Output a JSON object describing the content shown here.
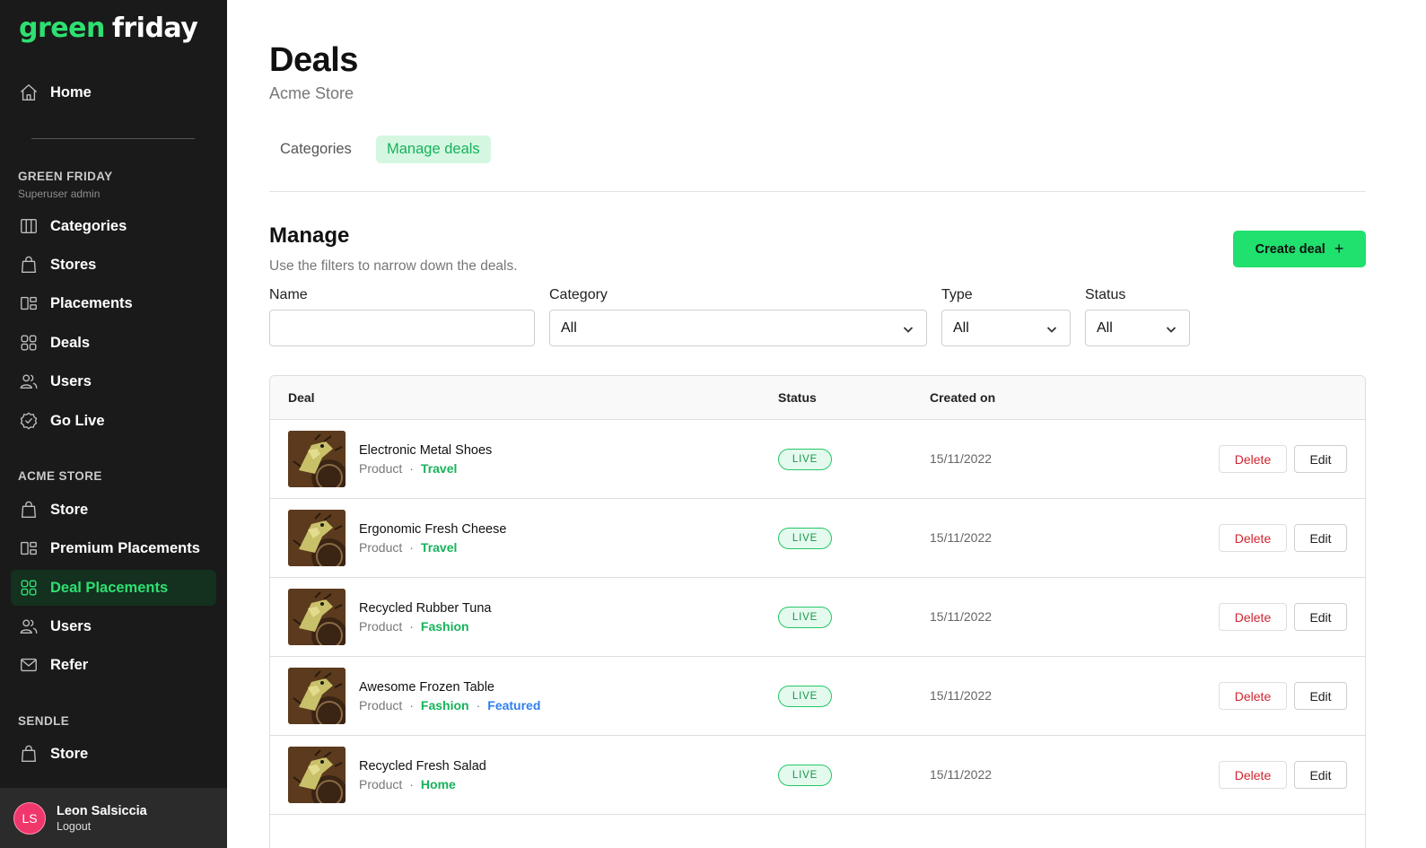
{
  "brand": {
    "part1": "green",
    "part2": "friday",
    "accent": "#2ee071"
  },
  "sidebar": {
    "home": {
      "label": "Home",
      "icon": "home-icon"
    },
    "section1": {
      "title": "GREEN FRIDAY",
      "subtitle": "Superuser admin"
    },
    "section1_items": [
      {
        "label": "Categories",
        "icon": "columns-icon"
      },
      {
        "label": "Stores",
        "icon": "shopping-bag-icon"
      },
      {
        "label": "Placements",
        "icon": "placements-icon"
      },
      {
        "label": "Deals",
        "icon": "grid-icon"
      },
      {
        "label": "Users",
        "icon": "users-icon"
      },
      {
        "label": "Go Live",
        "icon": "check-badge-icon"
      }
    ],
    "section2": {
      "title": "ACME STORE"
    },
    "section2_items": [
      {
        "label": "Store",
        "icon": "shopping-bag-icon"
      },
      {
        "label": "Premium Placements",
        "icon": "placements-icon"
      },
      {
        "label": "Deal Placements",
        "icon": "grid-icon",
        "active": true
      },
      {
        "label": "Users",
        "icon": "users-icon"
      },
      {
        "label": "Refer",
        "icon": "mail-icon"
      }
    ],
    "section3": {
      "title": "SENDLE"
    },
    "section3_items": [
      {
        "label": "Store",
        "icon": "shopping-bag-icon"
      }
    ],
    "user": {
      "initials": "LS",
      "name": "Leon Salsiccia",
      "logout": "Logout"
    }
  },
  "header": {
    "title": "Deals",
    "subtitle": "Acme Store"
  },
  "tabs": [
    {
      "label": "Categories",
      "active": false
    },
    {
      "label": "Manage deals",
      "active": true
    }
  ],
  "manage": {
    "title": "Manage",
    "subtitle": "Use the filters to narrow down the deals.",
    "create_label": "Create deal",
    "create_icon": "plus-icon"
  },
  "filters": {
    "name": {
      "label": "Name",
      "value": ""
    },
    "category": {
      "label": "Category",
      "value": "All"
    },
    "type": {
      "label": "Type",
      "value": "All"
    },
    "status": {
      "label": "Status",
      "value": "All"
    }
  },
  "table": {
    "columns": [
      "Deal",
      "Status",
      "Created on"
    ],
    "rows": [
      {
        "name": "Electronic Metal Shoes",
        "type": "Product",
        "category": "Travel",
        "featured": "",
        "status": "LIVE",
        "created": "15/11/2022",
        "delete": "Delete",
        "edit": "Edit"
      },
      {
        "name": "Ergonomic Fresh Cheese",
        "type": "Product",
        "category": "Travel",
        "featured": "",
        "status": "LIVE",
        "created": "15/11/2022",
        "delete": "Delete",
        "edit": "Edit"
      },
      {
        "name": "Recycled Rubber Tuna",
        "type": "Product",
        "category": "Fashion",
        "featured": "",
        "status": "LIVE",
        "created": "15/11/2022",
        "delete": "Delete",
        "edit": "Edit"
      },
      {
        "name": "Awesome Frozen Table",
        "type": "Product",
        "category": "Fashion",
        "featured": "Featured",
        "status": "LIVE",
        "created": "15/11/2022",
        "delete": "Delete",
        "edit": "Edit"
      },
      {
        "name": "Recycled Fresh Salad",
        "type": "Product",
        "category": "Home",
        "featured": "",
        "status": "LIVE",
        "created": "15/11/2022",
        "delete": "Delete",
        "edit": "Edit"
      }
    ]
  }
}
